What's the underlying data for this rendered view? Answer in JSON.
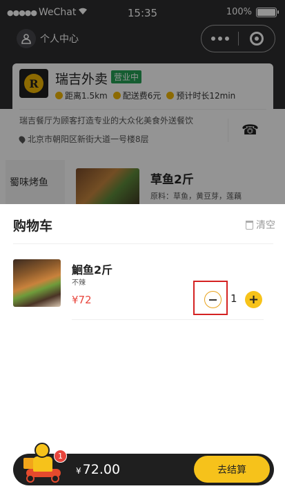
{
  "status_bar": {
    "carrier": "WeChat",
    "time": "15:35",
    "battery": "100%"
  },
  "nav": {
    "profile_label": "个人中心"
  },
  "shop": {
    "name": "瑞吉外卖",
    "logo_letter": "R",
    "status_badge": "营业中",
    "distance": "距离1.5km",
    "delivery_fee": "配送费6元",
    "eta": "预计时长12min",
    "description": "瑞吉餐厅为顾客打造专业的大众化美食外送餐饮",
    "address": "北京市朝阳区新街大道一号楼8层"
  },
  "menu_preview": {
    "category": "蜀味烤鱼",
    "product_name": "草鱼2斤",
    "product_ingredients": "原料：草鱼，黄豆芽，莲藕"
  },
  "cart": {
    "title": "购物车",
    "clear_label": "清空",
    "items": [
      {
        "name": "鮰鱼2斤",
        "spec": "不辣",
        "price": "¥72",
        "quantity": "1"
      }
    ]
  },
  "checkout": {
    "badge_count": "1",
    "currency": "¥",
    "total": "72.00",
    "button_label": "去结算"
  },
  "colors": {
    "accent_yellow": "#f6c21b",
    "price_red": "#e8453c",
    "open_green": "#25a055",
    "dark": "#2d2d2f"
  }
}
